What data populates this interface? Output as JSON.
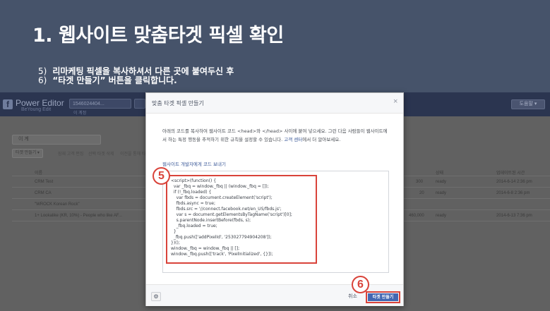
{
  "slide": {
    "title": "1. 웹사이트 맞춤타겟 픽셀 확인",
    "steps": [
      {
        "num": "5)",
        "text": "리마케팅 픽셀을 복사하셔서 다른 곳에 붙여두신 후"
      },
      {
        "num": "6)",
        "text": "“타겟 만들기” 버튼을 클릭합니다."
      }
    ]
  },
  "app": {
    "logo": "f",
    "name": "Power Editor",
    "sub": "BeYoung Edit",
    "account_value": "1546024404...",
    "account_sub": "이 계정",
    "user_button": "도움말 ▾",
    "filter_value": "이 계",
    "toolbar": [
      "타겟 만들기 ▾",
      "잠재 고객 편집",
      "선택 타겟 삭제",
      "이전을 통해 타겟 만들기"
    ],
    "columns": [
      "이름",
      "상태",
      "업데이트된 시간"
    ],
    "rows": [
      {
        "name": "CRM Test",
        "size": "300",
        "status": "ready",
        "time": "2014-6-14 2:36 pm"
      },
      {
        "name": "CRM CA",
        "size": "20",
        "status": "ready",
        "time": "2014-6-8 2:36 pm"
      },
      {
        "name": "\"WROCK Korean Rock\"",
        "size": "",
        "status": "",
        "time": ""
      },
      {
        "name": "1+ Lookalike (KR, 10%) - People who like AF...",
        "size": "460,000",
        "status": "ready",
        "time": "2014-6-13 7:36 pm"
      }
    ]
  },
  "modal": {
    "title": "맞춤 타겟 픽셀 만들기",
    "close_icon": "×",
    "description": "아래의 코드를 복사하여 웹사이트 코드 <head>와 </head> 사이에 붙여 넣으세요. 그런 다음 사람들이 웹사이트에서 하는 특정 행동을 추적하기 위한 규칙을 설정할 수 있습니다.",
    "help_link": "고객 센터",
    "description_tail": "에서 더 알아보세요.",
    "dev_link": "웹사이트 개발자에게 코드 보내기",
    "code_lines": [
      "<script>(function() {",
      "  var _fbq = window._fbq || (window._fbq = []);",
      "  if (!_fbq.loaded) {",
      "    var fbds = document.createElement('script');",
      "    fbds.async = true;",
      "    fbds.src = '//connect.facebook.net/en_US/fbds.js';",
      "    var s = document.getElementsByTagName('script')[0];",
      "    s.parentNode.insertBefore(fbds, s);",
      "    _fbq.loaded = true;",
      "  }",
      "  _fbq.push(['addPixelId', '253027794904208']);",
      "})();",
      "window._fbq = window._fbq || [];",
      "window._fbq.push(['track', 'PixelInitialized', {}]);"
    ],
    "gear_icon": "⚙",
    "cancel_label": "취소",
    "create_label": "타겟 만들기"
  },
  "callouts": [
    "5",
    "6"
  ],
  "colors": {
    "slide_bg": "#46536a",
    "callout": "#d9433a",
    "primary_button": "#4267b2",
    "link": "#3b5998"
  }
}
